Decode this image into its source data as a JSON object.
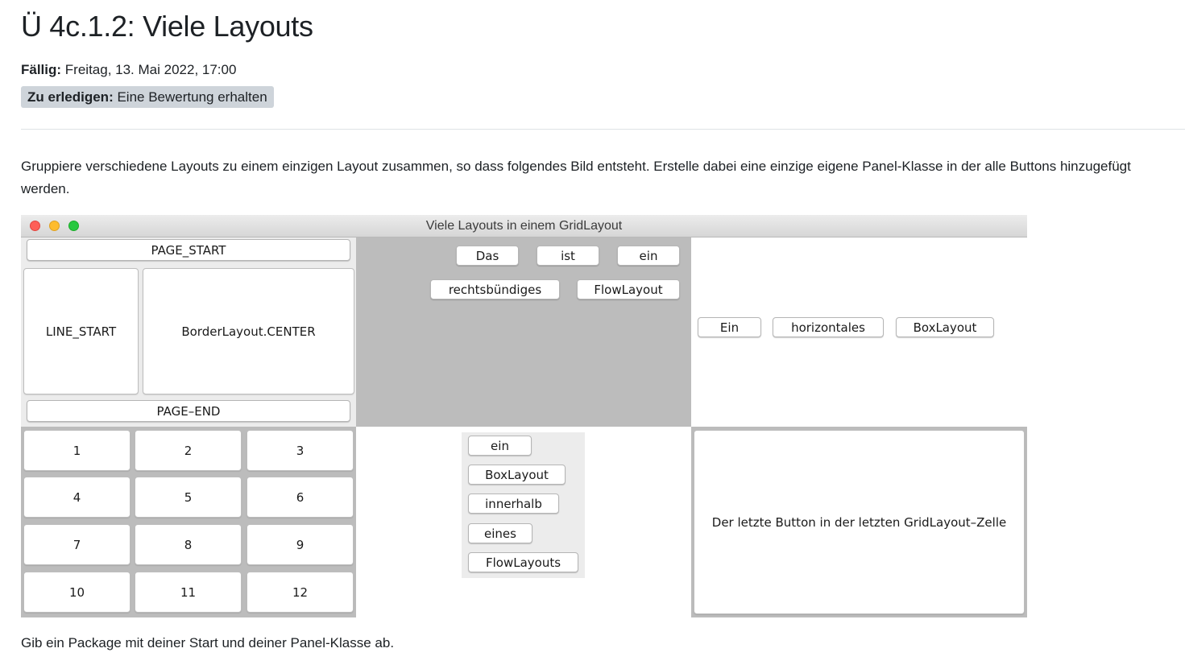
{
  "page": {
    "title": "Ü 4c.1.2: Viele Layouts",
    "due_label": "Fällig:",
    "due_value": "Freitag, 13. Mai 2022, 17:00",
    "todo_label": "Zu erledigen:",
    "todo_value": "Eine Bewertung erhalten",
    "description": "Gruppiere verschiedene Layouts zu einem einzigen Layout zusammen, so dass folgendes Bild entsteht. Erstelle dabei eine einzige eigene Panel-Klasse in der alle Buttons hinzugefügt werden.",
    "footer": "Gib ein Package mit deiner Start und deiner Panel-Klasse ab."
  },
  "window": {
    "title": "Viele Layouts in einem GridLayout",
    "colors": {
      "gray_panel": "#bcbcbc",
      "white_panel": "#ffffff",
      "light_panel": "#ececec"
    }
  },
  "border_layout": {
    "page_start": "PAGE_START",
    "line_start": "LINE_START",
    "center": "BorderLayout.CENTER",
    "page_end": "PAGE–END"
  },
  "flow_right": {
    "row1": [
      "Das",
      "ist",
      "ein"
    ],
    "row2": [
      "rechtsbündiges",
      "FlowLayout"
    ]
  },
  "box_horizontal": {
    "buttons": [
      "Ein",
      "horizontales",
      "BoxLayout"
    ]
  },
  "grid_numbers": {
    "buttons": [
      "1",
      "2",
      "3",
      "4",
      "5",
      "6",
      "7",
      "8",
      "9",
      "10",
      "11",
      "12"
    ]
  },
  "box_vertical": {
    "buttons": [
      "ein",
      "BoxLayout",
      "innerhalb",
      "eines",
      "FlowLayouts"
    ]
  },
  "last_cell": {
    "label": "Der letzte Button in der letzten GridLayout–Zelle"
  }
}
